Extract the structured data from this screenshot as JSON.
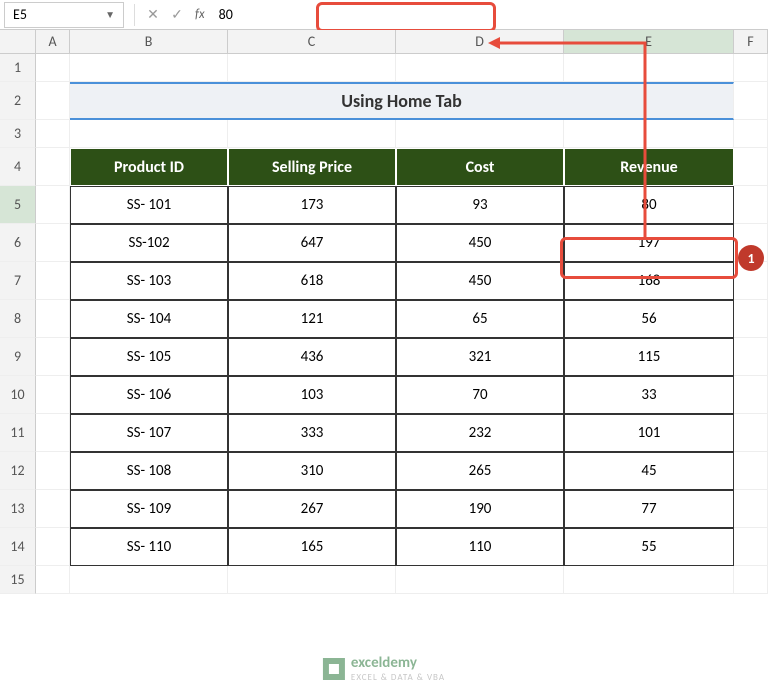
{
  "name_box": "E5",
  "fx_label": "fx",
  "formula_value": "80",
  "columns": [
    "A",
    "B",
    "C",
    "D",
    "E",
    "F"
  ],
  "title": "Using Home Tab",
  "headers": {
    "col1": "Product ID",
    "col2": "Selling Price",
    "col3": "Cost",
    "col4": "Revenue"
  },
  "rows": [
    {
      "id": "SS- 101",
      "price": "173",
      "cost": "93",
      "rev": "80"
    },
    {
      "id": "SS-102",
      "price": "647",
      "cost": "450",
      "rev": "197"
    },
    {
      "id": "SS- 103",
      "price": "618",
      "cost": "450",
      "rev": "168"
    },
    {
      "id": "SS- 104",
      "price": "121",
      "cost": "65",
      "rev": "56"
    },
    {
      "id": "SS- 105",
      "price": "436",
      "cost": "321",
      "rev": "115"
    },
    {
      "id": "SS- 106",
      "price": "103",
      "cost": "70",
      "rev": "33"
    },
    {
      "id": "SS- 107",
      "price": "333",
      "cost": "232",
      "rev": "101"
    },
    {
      "id": "SS- 108",
      "price": "310",
      "cost": "265",
      "rev": "45"
    },
    {
      "id": "SS- 109",
      "price": "267",
      "cost": "190",
      "rev": "77"
    },
    {
      "id": "SS- 110",
      "price": "165",
      "cost": "110",
      "rev": "55"
    }
  ],
  "row_numbers": [
    "1",
    "2",
    "3",
    "4",
    "5",
    "6",
    "7",
    "8",
    "9",
    "10",
    "11",
    "12",
    "13",
    "14",
    "15"
  ],
  "annotation": {
    "badge": "1"
  },
  "watermark": {
    "brand": "exceldemy",
    "tag": "EXCEL & DATA & VBA"
  }
}
